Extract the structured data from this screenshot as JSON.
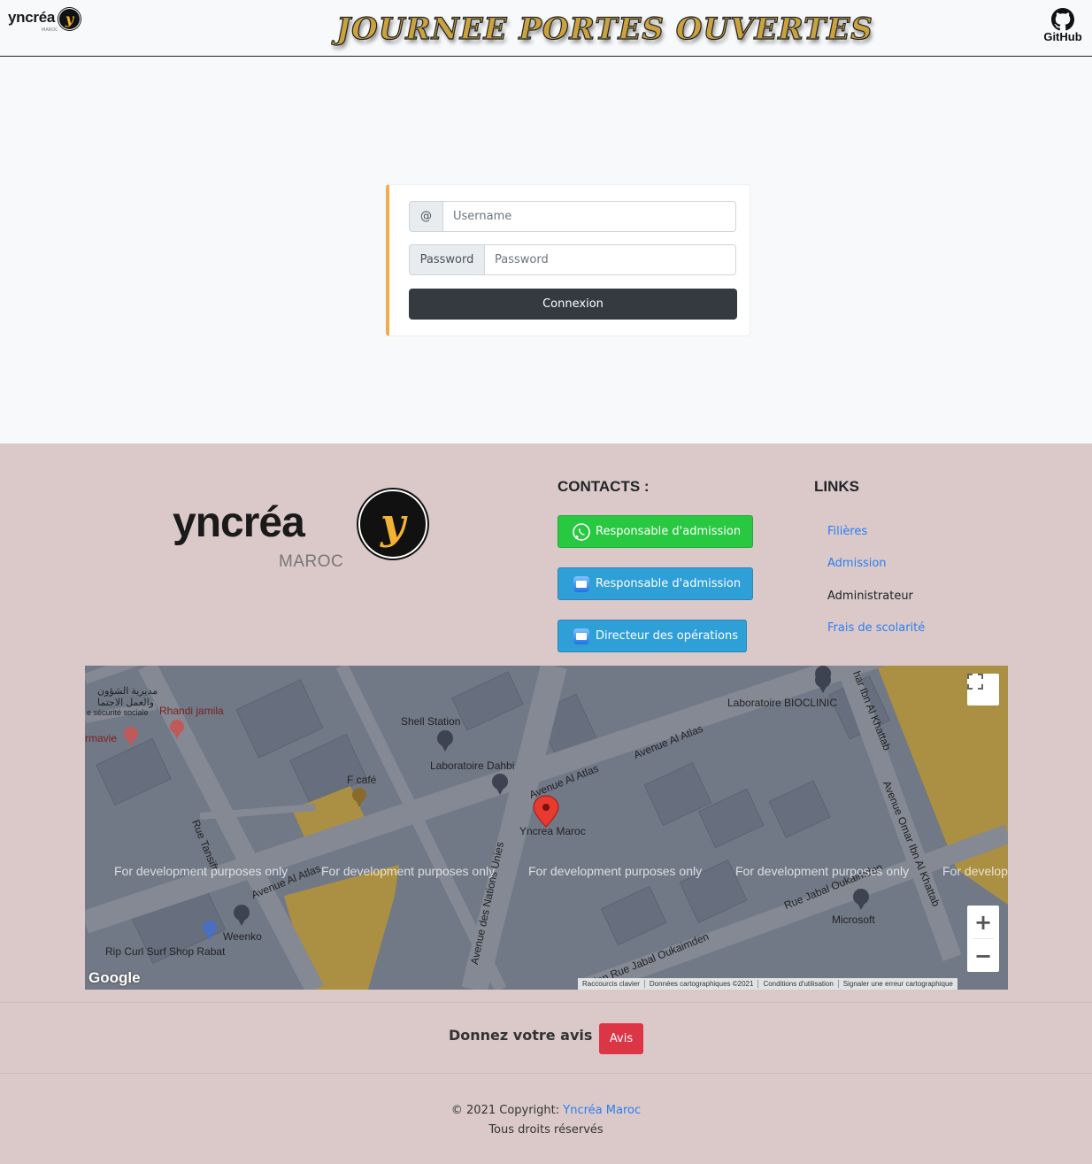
{
  "header": {
    "brand_word": "yncréa",
    "brand_sub": "MAROC",
    "brand_mark": "y",
    "title": "JOURNEE PORTES OUVERTES",
    "github_label": "GitHub"
  },
  "login": {
    "username_addon": "@",
    "username_placeholder": "Username",
    "username_value": "",
    "password_addon": "Password",
    "password_placeholder": "Password",
    "password_value": "",
    "submit_label": "Connexion",
    "accent_color": "#f0ad4e"
  },
  "footer": {
    "logo_word": "yncréa",
    "logo_sub": "MAROC",
    "logo_mark": "y",
    "contacts_heading": "CONTACTS :",
    "contacts": [
      {
        "label": "Responsable d'admission",
        "icon": "whatsapp-icon",
        "color": "#28c840"
      },
      {
        "label": "Responsable d'admission",
        "icon": "mail-icon",
        "color": "#2f9fd8"
      },
      {
        "label": "Directeur des opérations",
        "icon": "mail-icon",
        "color": "#2f9fd8"
      }
    ],
    "links_heading": "LINKS",
    "links": [
      {
        "label": "Filières"
      },
      {
        "label": "Admission"
      },
      {
        "label": "Administrateur"
      },
      {
        "label": "Frais de scolarité"
      }
    ],
    "feedback_text": "Donnez votre avis !",
    "feedback_button": "Avis",
    "copyright_prefix": "© 2021 Copyright:",
    "copyright_link": "Yncréa Maroc",
    "rights": "Tous droits réservés"
  },
  "map": {
    "marker_label": "Yncrea Maroc",
    "watermark": "For development purposes only",
    "watermark_cut": "For develop",
    "places": {
      "bioclinic": "Laboratoire BIOCLINIC",
      "shell": "Shell Station",
      "dahbi": "Laboratoire Dahbi",
      "fcafe": "F café",
      "rhandi": "Rhandi jamila",
      "securite": "e sécurité sociale",
      "arabic1": "مديرية الشؤون",
      "arabic2": "والعمل الاجتما",
      "armavie": "rmavie",
      "weenko": "Weenko",
      "ripcurl": "Rip Curl Surf Shop Rabat",
      "microsoft": "Microsoft"
    },
    "streets": {
      "atlas1": "Avenue Al Atlas",
      "atlas2": "Avenue Al Atlas",
      "atlas3": "Avenue Al Atlas",
      "tansift": "Rue Tansift",
      "nations": "Avenue des Nations Unies",
      "omar1": "har Ibn Al Khattab",
      "omar2": "Avenue Omar Ibn Al Khattab",
      "jabal1": "Rue Jabal Oukaimden",
      "jabal2": "den  Rue Jabal Oukaimden"
    },
    "attribution": [
      "Raccourcis clavier",
      "Données cartographiques ©2021",
      "Conditions d'utilisation",
      "Signaler une erreur cartographique"
    ],
    "google_logo": "Google",
    "zoom_in": "+",
    "zoom_out": "−"
  }
}
